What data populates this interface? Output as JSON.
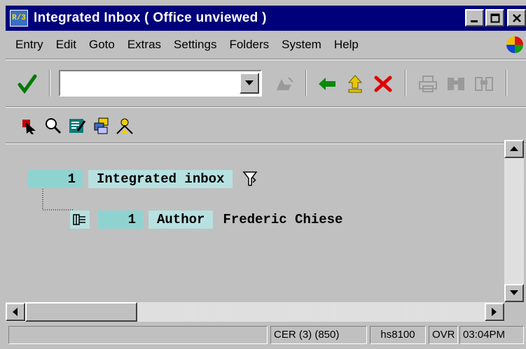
{
  "window": {
    "title": "Integrated Inbox  ( Office unviewed )",
    "app_icon_text": "R/3",
    "min_label": "_",
    "max_label": "□",
    "close_label": "✕"
  },
  "menu": [
    "Entry",
    "Edit",
    "Goto",
    "Extras",
    "Settings",
    "Folders",
    "System",
    "Help"
  ],
  "toolbar": {
    "command_field_value": "",
    "icons": [
      "check-icon",
      "dropdown-arrow-icon",
      "save-icon",
      "back-icon",
      "exit-icon",
      "cancel-icon",
      "print-icon",
      "find-icon",
      "find-next-icon"
    ]
  },
  "app_toolbar": {
    "icons": [
      "select-icon",
      "search-icon",
      "edit-icon",
      "workflow-icon",
      "user-icon"
    ]
  },
  "tree": {
    "root": {
      "count": "1",
      "label": "Integrated inbox",
      "filter_icon": "filter-icon"
    },
    "child": {
      "count": "1",
      "label": "Author",
      "value": "Frederic Chiese",
      "icon": "folder-tree-icon"
    }
  },
  "status": {
    "system": "CER (3) (850)",
    "server": "hs8100",
    "mode": "OVR",
    "time": "03:04PM"
  },
  "colors": {
    "title_bg": "#00007b",
    "window_bg": "#c0c0c0",
    "count_bg": "#8fd3d1",
    "label_bg": "#b7e1e0"
  }
}
